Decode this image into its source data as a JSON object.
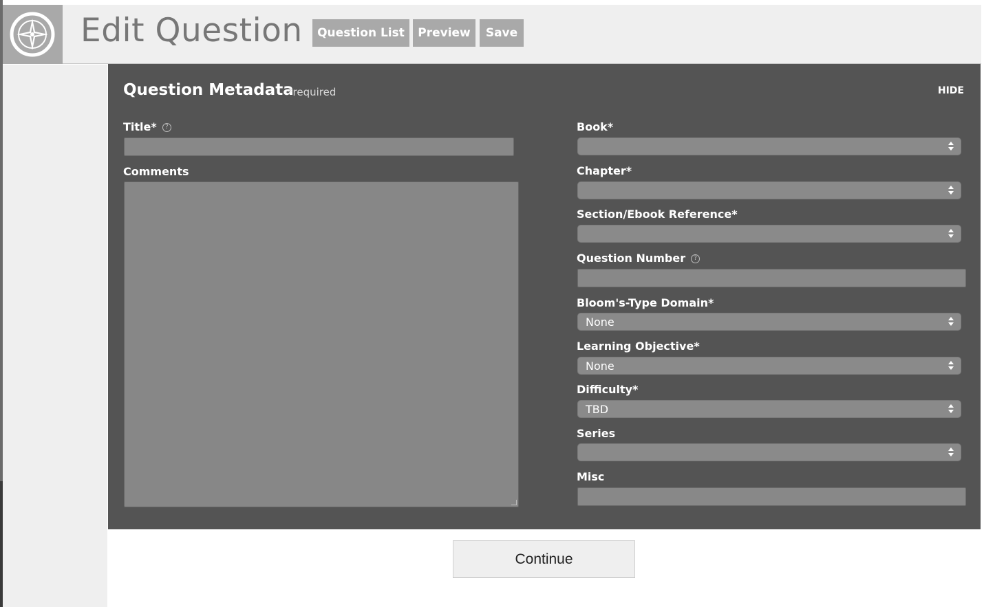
{
  "header": {
    "title": "Edit Question",
    "buttons": {
      "question_list": "Question List",
      "preview": "Preview",
      "save": "Save"
    },
    "logo_icon": "compass-icon"
  },
  "panel": {
    "title": "Question Metadata",
    "required_note": "*required",
    "hide_label": "HIDE",
    "colors": {
      "background": "#545454",
      "field": "#888888"
    }
  },
  "form": {
    "title": {
      "label": "Title*",
      "value": ""
    },
    "comments": {
      "label": "Comments",
      "value": ""
    },
    "book": {
      "label": "Book*",
      "value": ""
    },
    "chapter": {
      "label": "Chapter*",
      "value": ""
    },
    "section": {
      "label": "Section/Ebook Reference*",
      "value": ""
    },
    "question_number": {
      "label": "Question Number",
      "value": ""
    },
    "blooms": {
      "label": "Bloom's-Type Domain*",
      "value": "None"
    },
    "learning_objective": {
      "label": "Learning Objective*",
      "value": "None"
    },
    "difficulty": {
      "label": "Difficulty*",
      "value": "TBD"
    },
    "series": {
      "label": "Series",
      "value": ""
    },
    "misc": {
      "label": "Misc",
      "value": ""
    }
  },
  "help_icon_glyph": "?",
  "footer": {
    "continue_label": "Continue"
  }
}
